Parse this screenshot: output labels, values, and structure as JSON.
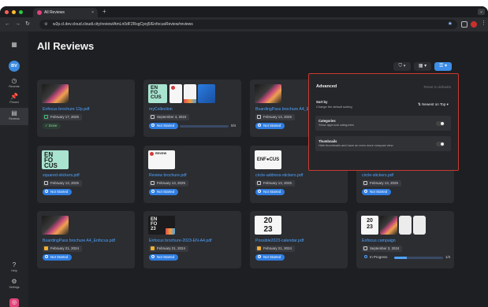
{
  "browser": {
    "tab_title": "All Reviews",
    "tab_close": "×",
    "new_tab": "+",
    "url": "w2p.cl.dev.cloud.cloudi.city/review/AmLn0dF2RsgCpoj5/EnfocusReview/reviews"
  },
  "sidebar": {
    "avatar_initials": "BV",
    "items": [
      {
        "label": "Recents",
        "icon": "clock-icon"
      },
      {
        "label": "Pinned",
        "icon": "pin-icon"
      },
      {
        "label": "Reviews",
        "icon": "reviews-icon"
      },
      {
        "label": "Help",
        "icon": "help-icon"
      },
      {
        "label": "Settings",
        "icon": "gear-icon"
      }
    ]
  },
  "page": {
    "title": "All Reviews"
  },
  "advanced": {
    "title": "Advanced",
    "reset_label": "Reset to defaults",
    "sort_title": "Sort by",
    "sort_desc": "Change the default sorting",
    "sort_value": "Newest on Top",
    "categories_title": "Categories",
    "categories_desc": "Show approval categories",
    "thumbnails_title": "Thumbnails",
    "thumbnails_desc": "Hide thumbnails and have an even more compact view"
  },
  "reviews": [
    {
      "name": "Enfocus brochure 12p.pdf",
      "date": "February 17, 2025",
      "status": "Done"
    },
    {
      "name": "myCollection",
      "date": "September 4, 2024",
      "status": "Not Started",
      "progress_text": "0/4",
      "progress": 0
    },
    {
      "name": "BoardingPass brochure A4_Enfocus.pdf",
      "date": "February 13, 2025",
      "status": "Not Started"
    },
    {
      "name": "squared-stickers.pdf",
      "date": "February 13, 2025",
      "status": "Not Started"
    },
    {
      "name": "Review brochure.pdf",
      "date": "February 13, 2025",
      "status": "Not Started"
    },
    {
      "name": "circle-address-stickers.pdf",
      "date": "February 13, 2025",
      "status": "Not Started"
    },
    {
      "name": "circle-stickers.pdf",
      "date": "February 13, 2025",
      "status": "Not Started"
    },
    {
      "name": "BoardingPass brochure A4_Enfocus.pdf",
      "date": "February 21, 2024",
      "status": "Not Started"
    },
    {
      "name": "Enfocus brochure-2023-EN-A4.pdf",
      "date": "February 21, 2024",
      "status": "Not Started"
    },
    {
      "name": "Possible2023-calendar.pdf",
      "date": "February 21, 2024",
      "status": "Not Started"
    },
    {
      "name": "Enfocus campaign",
      "date": "September 3, 2024",
      "status": "In Progress",
      "progress_text": "1/4",
      "progress": 0.25
    }
  ],
  "thumb_text": {
    "enfocus": "EN\nFO\nCUS",
    "review": "REVIEW",
    "enfocus_logo": "ENF●CUS",
    "cus": "CUS",
    "year": "20\n23",
    "fo": "FO\n23"
  }
}
